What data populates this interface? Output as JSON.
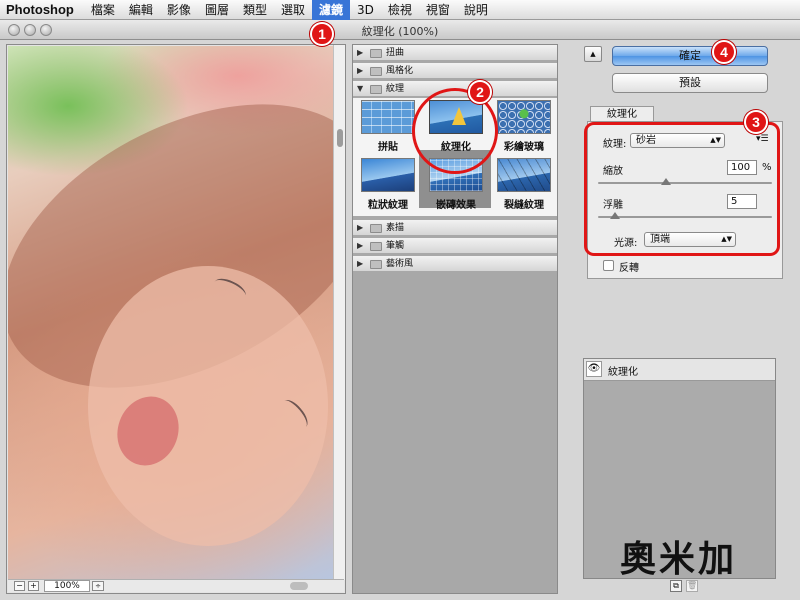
{
  "menubar": {
    "app": "Photoshop",
    "items": [
      "檔案",
      "編輯",
      "影像",
      "圖層",
      "類型",
      "選取",
      "濾鏡",
      "3D",
      "檢視",
      "視窗",
      "說明"
    ],
    "active_index": 6
  },
  "window": {
    "title": "紋理化 (100%)"
  },
  "preview": {
    "zoom": "100%",
    "minus": "−",
    "plus": "+",
    "zoom_arrow": "÷"
  },
  "gallery": {
    "categories_top": [
      {
        "label": "扭曲",
        "expanded": false
      },
      {
        "label": "風格化",
        "expanded": false
      },
      {
        "label": "紋理",
        "expanded": true
      }
    ],
    "texture_filters": [
      {
        "label": "拼貼",
        "selected": false
      },
      {
        "label": "紋理化",
        "selected": true
      },
      {
        "label": "彩繪玻璃",
        "selected": false
      },
      {
        "label": "粒狀紋理",
        "selected": false
      },
      {
        "label": "嵌磚效果",
        "selected": false
      },
      {
        "label": "裂縫紋理",
        "selected": false
      }
    ],
    "categories_bottom": [
      {
        "label": "素描",
        "expanded": false
      },
      {
        "label": "筆觸",
        "expanded": false
      },
      {
        "label": "藝術風",
        "expanded": false
      }
    ]
  },
  "buttons": {
    "ok": "確定",
    "reset": "預設",
    "collapse": "▲"
  },
  "settings": {
    "tab_label": "紋理化",
    "texture_label": "紋理:",
    "texture_value": "砂岩",
    "scaling_label": "縮放",
    "scaling_value": "100",
    "scaling_unit": "%",
    "scaling_level": 0.39,
    "relief_label": "浮雕",
    "relief_value": "5",
    "relief_level": 0.1,
    "light_label": "光源:",
    "light_value": "頂端",
    "invert_label": "反轉",
    "invert_checked": false
  },
  "layers": {
    "items": [
      {
        "label": "紋理化",
        "visible": true
      }
    ]
  },
  "markers": [
    "1",
    "2",
    "3",
    "4"
  ],
  "watermark": "奧米加",
  "colors": {
    "accent": "#3875d7",
    "marker": "#e01616"
  }
}
